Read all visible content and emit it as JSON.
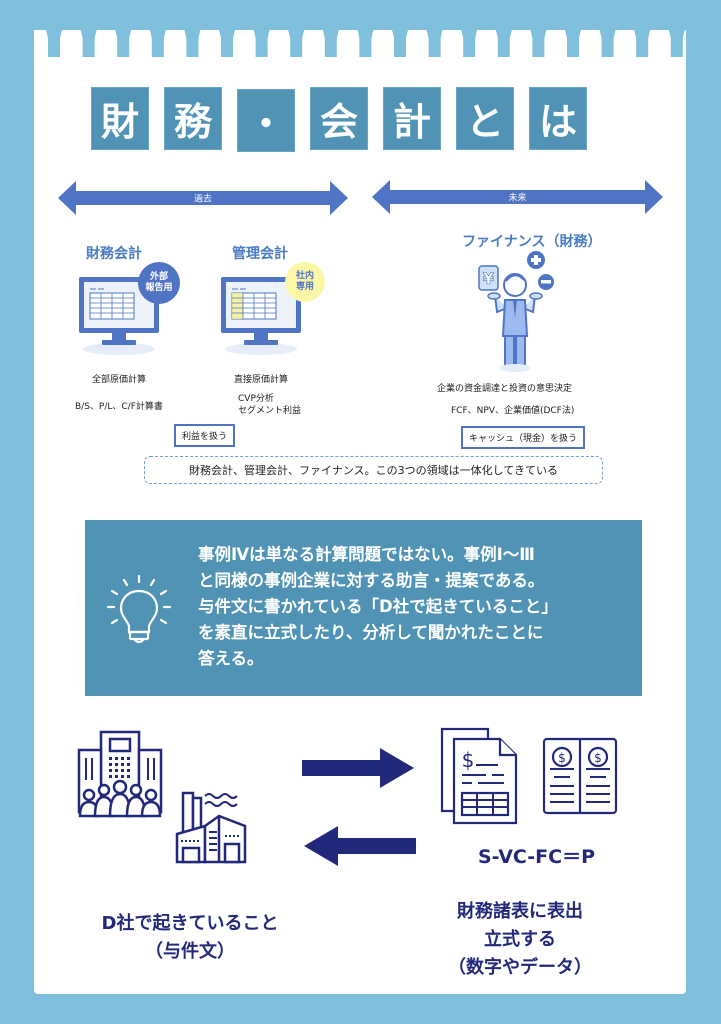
{
  "title": {
    "tiles": [
      "財",
      "務",
      "・",
      "会",
      "計",
      "と",
      "は"
    ]
  },
  "timeline": {
    "past_label": "過去",
    "future_label": "未来"
  },
  "financial_accounting": {
    "title": "財務会計",
    "badge": "外部\n報告用",
    "badge_line1": "外部",
    "badge_line2": "報告用",
    "item1": "全部原価計算",
    "item2": "B/S、P/L、C/F計算書"
  },
  "management_accounting": {
    "title": "管理会計",
    "badge_line1": "社内",
    "badge_line2": "専用",
    "item1": "直接原価計算",
    "item2_line1": "CVP分析",
    "item2_line2": "セグメント利益"
  },
  "profit_box": "利益を扱う",
  "finance": {
    "title": "ファイナンス（財務）",
    "item1": "企業の資金調達と投資の意思決定",
    "item2": "FCF、NPV、企業価値(DCF法)",
    "cash_box": "キャッシュ（現金）を扱う"
  },
  "summary": "財務会計、管理会計、ファイナンス。この3つの領域は一体化してきている",
  "info": {
    "lines": [
      "事例Ⅳは単なる計算問題ではない。事例Ⅰ～Ⅲ",
      "と同様の事例企業に対する助言・提案である。",
      "与件文に書かれている「D社で起きていること」",
      "を素直に立式したり、分析して聞かれたことに",
      "答える。"
    ]
  },
  "flow": {
    "formula": "S-VC-FC＝P",
    "left_line1": "D社で起きていること",
    "left_line2": "（与件文）",
    "right_line1": "財務諸表に表出",
    "right_line2": "立式する",
    "right_line3": "（数字やデータ）"
  },
  "colors": {
    "background": "#80bfdc",
    "tile": "#5093b5",
    "arrow_blue": "#4f74c4",
    "navy": "#23297a",
    "badge_yellow": "#fcf7a6"
  }
}
